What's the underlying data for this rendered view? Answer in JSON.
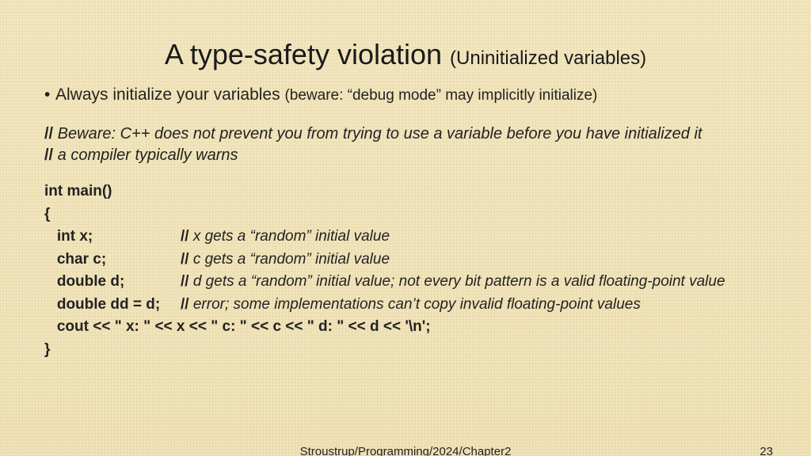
{
  "title": {
    "main": "A type-safety violation ",
    "sub": "(Uninitialized variables)"
  },
  "bullet": {
    "lead": "Always initialize your variables ",
    "note": " (beware: “debug mode” may implicitly initialize)"
  },
  "warn": {
    "slashes": "//",
    "line1": " Beware: C++ does not prevent you from trying to use a variable before you have initialized it",
    "line2": " a compiler typically warns"
  },
  "code": {
    "slashes": "//",
    "l1": "int main()",
    "l2": "{",
    "int_x": "   int x;",
    "int_x_c": " x gets a “random” initial value",
    "char_c": "   char c;",
    "char_c_c": " c gets a “random” initial value",
    "double_d": "   double d;",
    "double_d_c": " d gets a “random” initial value; not every bit pattern is a valid floating-point value",
    "double_dd": "   double dd = d;",
    "double_dd_c": " error; some implementations can’t copy invalid floating-point values",
    "cout": "   cout << \" x: \" << x << \" c: \" << c << \" d: \" << d << '\\n';",
    "close": "}"
  },
  "footer": {
    "center": "Stroustrup/Programming/2024/Chapter2",
    "page": "23"
  }
}
